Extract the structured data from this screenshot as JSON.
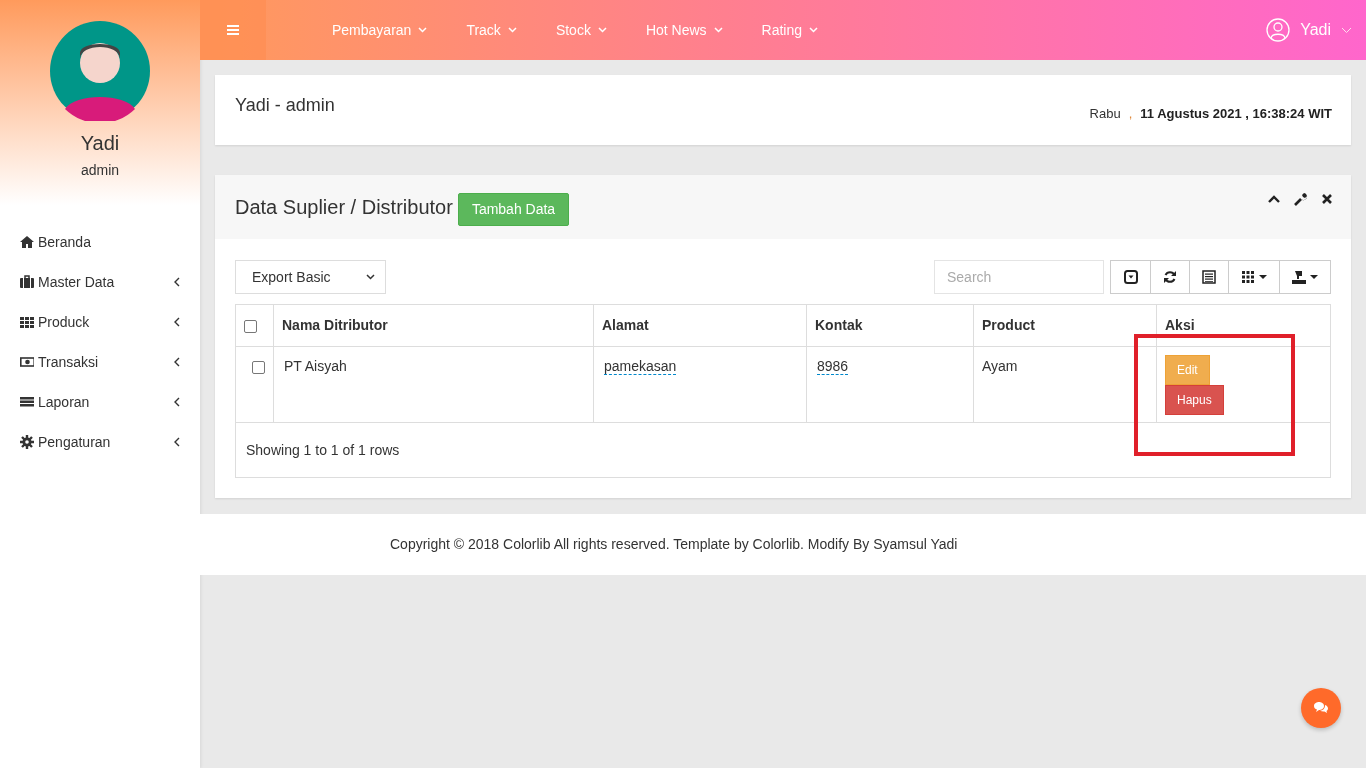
{
  "sidebar": {
    "user_name": "Yadi",
    "user_role": "admin",
    "items": [
      {
        "label": "Beranda"
      },
      {
        "label": "Master Data"
      },
      {
        "label": "Produck"
      },
      {
        "label": "Transaksi"
      },
      {
        "label": "Laporan"
      },
      {
        "label": "Pengaturan"
      }
    ]
  },
  "topbar": {
    "menu": [
      "Pembayaran",
      "Track",
      "Stock",
      "Hot News",
      "Rating"
    ],
    "user": "Yadi"
  },
  "info_panel": {
    "title": "Yadi - admin",
    "day": "Rabu",
    "separator": ",",
    "datetime": "11 Agustus 2021 , 16:38:24 WIT"
  },
  "data_panel": {
    "title": "Data Suplier / Distributor",
    "add_button": "Tambah Data",
    "export_select": "Export Basic",
    "search": {
      "placeholder": "Search"
    },
    "table": {
      "columns": [
        "Nama Ditributor",
        "Alamat",
        "Kontak",
        "Product",
        "Aksi"
      ],
      "header_checked": false,
      "rows": [
        {
          "checked": false,
          "cells": [
            "PT Aisyah",
            "pamekasan",
            "8986",
            "Ayam"
          ],
          "editable": [
            false,
            true,
            true,
            false
          ],
          "actions": [
            "Edit",
            "Hapus"
          ]
        }
      ]
    },
    "pagination_info": "Showing 1 to 1 of 1 rows"
  },
  "footer": "Copyright © 2018 Colorlib All rights reserved. Template by Colorlib. Modify By Syamsul Yadi"
}
